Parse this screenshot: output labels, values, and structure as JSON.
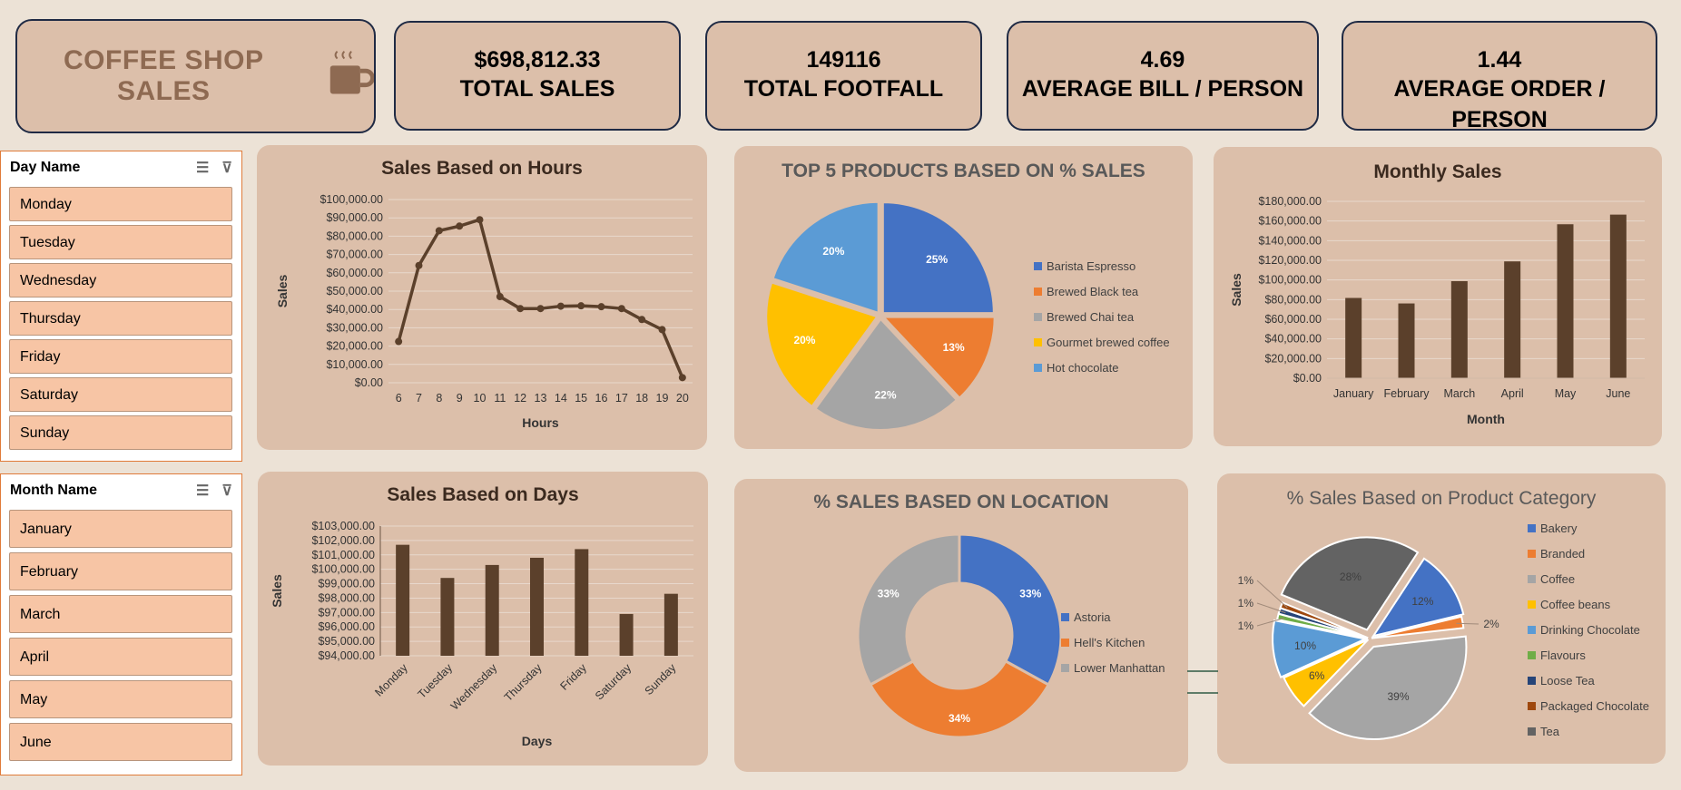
{
  "header": {
    "title": "COFFEE SHOP SALES",
    "kpis": [
      {
        "value": "$698,812.33",
        "label": "TOTAL SALES"
      },
      {
        "value": "149116",
        "label": "TOTAL FOOTFALL"
      },
      {
        "value": "4.69",
        "label": "AVERAGE BILL / PERSON"
      },
      {
        "value": "1.44",
        "label": "AVERAGE ORDER / PERSON"
      }
    ]
  },
  "slicers": {
    "day": {
      "title": "Day Name",
      "items": [
        "Monday",
        "Tuesday",
        "Wednesday",
        "Thursday",
        "Friday",
        "Saturday",
        "Sunday"
      ]
    },
    "month": {
      "title": "Month Name",
      "items": [
        "January",
        "February",
        "March",
        "April",
        "May",
        "June"
      ]
    }
  },
  "colors": {
    "bar": "#5b402b",
    "panel": "#dcbfaa",
    "slicer_item": "#f7c5a5"
  },
  "chart_data": [
    {
      "id": "hours",
      "type": "line",
      "title": "Sales Based on Hours",
      "xlabel": "Hours",
      "ylabel": "Sales",
      "x": [
        6,
        7,
        8,
        9,
        10,
        11,
        12,
        13,
        14,
        15,
        16,
        17,
        18,
        19,
        20
      ],
      "values": [
        22500,
        64000,
        83000,
        85500,
        89000,
        47000,
        40500,
        40500,
        41800,
        42000,
        41500,
        40500,
        34500,
        29000,
        2800
      ],
      "yticks": [
        "$100,000.00",
        "$90,000.00",
        "$80,000.00",
        "$70,000.00",
        "$60,000.00",
        "$50,000.00",
        "$40,000.00",
        "$30,000.00",
        "$20,000.00",
        "$10,000.00",
        "$0.00"
      ],
      "ylim": [
        0,
        100000
      ]
    },
    {
      "id": "products",
      "type": "pie",
      "title": "TOP 5 PRODUCTS BASED ON % SALES",
      "labels": [
        "Barista Espresso",
        "Brewed Black tea",
        "Brewed Chai tea",
        "Gourmet brewed coffee",
        "Hot chocolate"
      ],
      "values": [
        25,
        13,
        22,
        20,
        20
      ],
      "value_labels": [
        "25%",
        "13%",
        "22%",
        "20%",
        "20%"
      ],
      "colors": [
        "#4472c4",
        "#ed7d31",
        "#a5a5a5",
        "#ffc000",
        "#5b9bd5"
      ]
    },
    {
      "id": "monthly",
      "type": "bar",
      "title": "Monthly Sales",
      "xlabel": "Month",
      "ylabel": "Sales",
      "categories": [
        "January",
        "February",
        "March",
        "April",
        "May",
        "June"
      ],
      "values": [
        81700,
        76100,
        98800,
        118900,
        156700,
        166500
      ],
      "yticks": [
        "$180,000.00",
        "$160,000.00",
        "$140,000.00",
        "$120,000.00",
        "$100,000.00",
        "$80,000.00",
        "$60,000.00",
        "$40,000.00",
        "$20,000.00",
        "$0.00"
      ],
      "ylim": [
        0,
        180000
      ]
    },
    {
      "id": "days",
      "type": "bar",
      "title": "Sales Based on Days",
      "xlabel": "Days",
      "ylabel": "Sales",
      "categories": [
        "Monday",
        "Tuesday",
        "Wednesday",
        "Thursday",
        "Friday",
        "Saturday",
        "Sunday"
      ],
      "values": [
        101700,
        99400,
        100300,
        100800,
        101400,
        96900,
        98300
      ],
      "yticks": [
        "$103,000.00",
        "$102,000.00",
        "$101,000.00",
        "$100,000.00",
        "$99,000.00",
        "$98,000.00",
        "$97,000.00",
        "$96,000.00",
        "$95,000.00",
        "$94,000.00"
      ],
      "ylim": [
        94000,
        103000
      ]
    },
    {
      "id": "location",
      "type": "pie",
      "title": "% SALES BASED ON LOCATION",
      "labels": [
        "Astoria",
        "Hell's Kitchen",
        "Lower Manhattan"
      ],
      "values": [
        33,
        34,
        33
      ],
      "value_labels": [
        "33%",
        "34%",
        "33%"
      ],
      "colors": [
        "#4472c4",
        "#ed7d31",
        "#a5a5a5"
      ]
    },
    {
      "id": "category",
      "type": "pie",
      "title": "% Sales Based on Product Category",
      "labels": [
        "Bakery",
        "Branded",
        "Coffee",
        "Coffee beans",
        "Drinking Chocolate",
        "Flavours",
        "Loose Tea",
        "Packaged Chocolate",
        "Tea"
      ],
      "values": [
        12,
        2,
        39,
        6,
        10,
        1,
        1,
        1,
        28
      ],
      "value_labels": [
        "12%",
        "2%",
        "39%",
        "6%",
        "10%",
        "1%",
        "1%",
        "1%",
        "28%"
      ],
      "colors": [
        "#4472c4",
        "#ed7d31",
        "#a5a5a5",
        "#ffc000",
        "#5b9bd5",
        "#70ad47",
        "#264478",
        "#9e480e",
        "#636363"
      ]
    }
  ]
}
